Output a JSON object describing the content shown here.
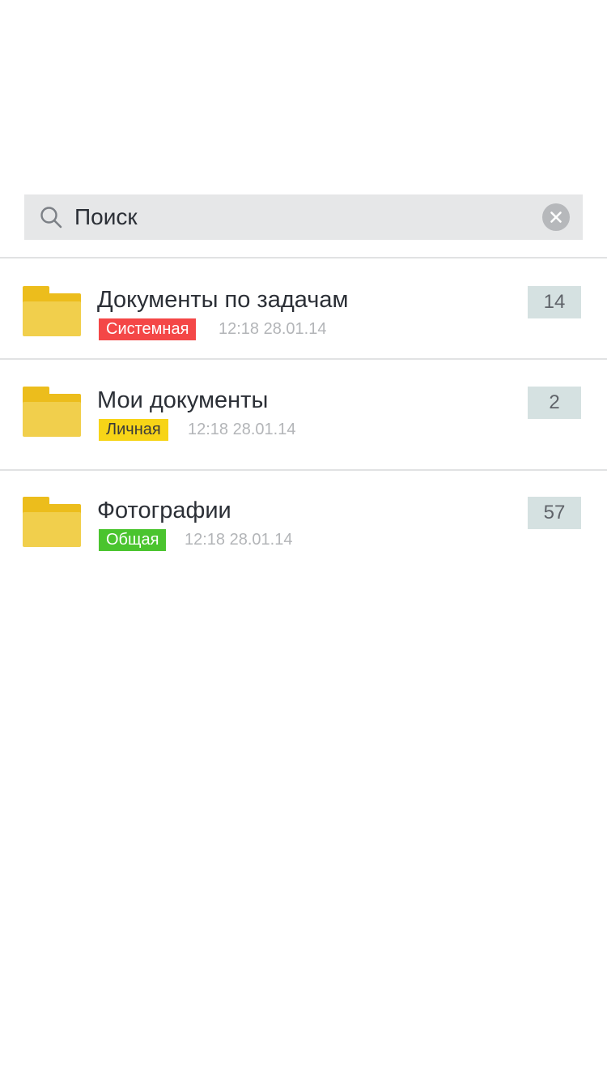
{
  "search": {
    "placeholder": "Поиск",
    "value": ""
  },
  "folders": [
    {
      "name": "Документы по задачам",
      "badge": "Системная",
      "badge_bg": "#f44747",
      "badge_color": "#ffffff",
      "date": "12:18 28.01.14",
      "count": "14"
    },
    {
      "name": "Мои документы",
      "badge": "Личная",
      "badge_bg": "#f7d417",
      "badge_color": "#3a3a3a",
      "date": "12:18 28.01.14",
      "count": "2"
    },
    {
      "name": "Фотографии",
      "badge": "Общая",
      "badge_bg": "#4ac42e",
      "badge_color": "#ffffff",
      "date": "12:18 28.01.14",
      "count": "57"
    }
  ],
  "colors": {
    "folder_tab": "#ecbd1c",
    "folder_body": "#f1cf4c",
    "search_bg": "#e6e7e8",
    "count_bg": "#d5e1e1"
  },
  "icons": {
    "search": "search-icon",
    "clear": "close-icon",
    "folder": "folder-icon"
  }
}
